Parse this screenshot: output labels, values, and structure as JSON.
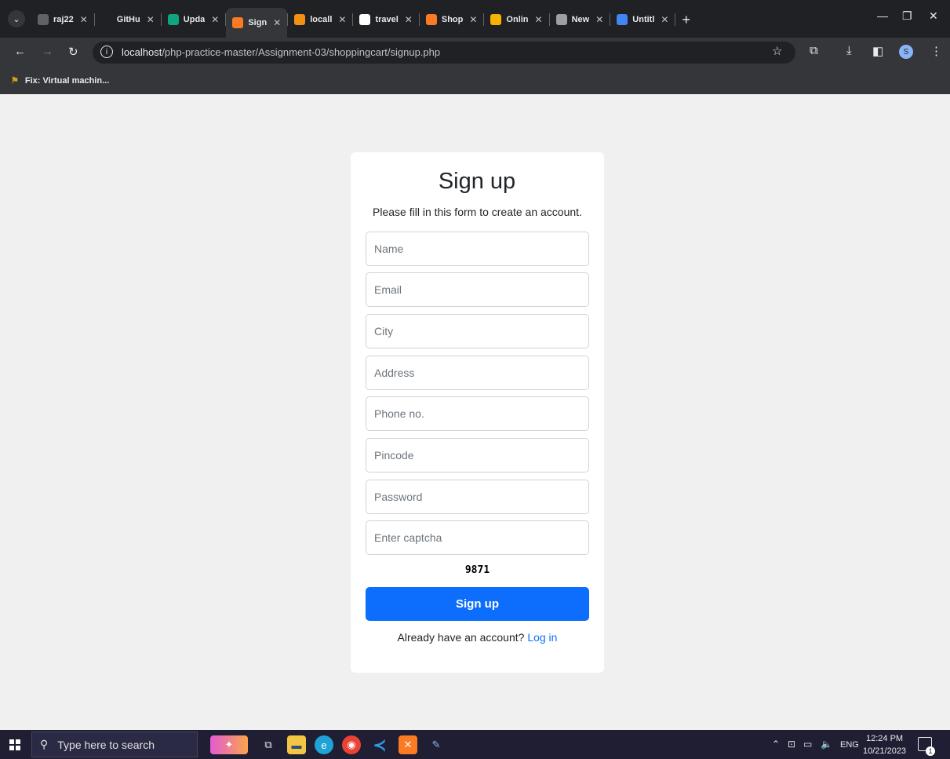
{
  "browser": {
    "tabs": [
      {
        "label": "raj22",
        "icon": "edit-icon",
        "color": "#5f6368",
        "active": false
      },
      {
        "label": "GitHu",
        "icon": "github-icon",
        "color": "#202124",
        "active": false
      },
      {
        "label": "Upda",
        "icon": "chatgpt-icon",
        "color": "#10a37f",
        "active": false
      },
      {
        "label": "Sign",
        "icon": "xampp-icon",
        "color": "#fb7a24",
        "active": true
      },
      {
        "label": "locall",
        "icon": "phpmyadmin-icon",
        "color": "#f29111",
        "active": false
      },
      {
        "label": "travel",
        "icon": "google-icon",
        "color": "#ffffff",
        "active": false
      },
      {
        "label": "Shop",
        "icon": "xampp-icon",
        "color": "#fb7a24",
        "active": false
      },
      {
        "label": "Onlin",
        "icon": "online-icon",
        "color": "#f4b400",
        "active": false
      },
      {
        "label": "New",
        "icon": "chrome-icon",
        "color": "#9aa0a6",
        "active": false
      },
      {
        "label": "Untitl",
        "icon": "docs-icon",
        "color": "#4285f4",
        "active": false
      }
    ],
    "url_host": "localhost",
    "url_path": "/php-practice-master/Assignment-03/shoppingcart/signup.php",
    "bookmark": "Fix: Virtual machin...",
    "profile_initial": "S"
  },
  "form": {
    "title": "Sign up",
    "subtitle": "Please fill in this form to create an account.",
    "placeholders": {
      "name": "Name",
      "email": "Email",
      "city": "City",
      "address": "Address",
      "phone": "Phone no.",
      "pincode": "Pincode",
      "password": "Password",
      "captcha": "Enter captcha"
    },
    "captcha_code": "9871",
    "submit_label": "Sign up",
    "login_prompt": "Already have an account?",
    "login_link": "Log in"
  },
  "taskbar": {
    "search_placeholder": "Type here to search",
    "language": "ENG",
    "time": "12:24 PM",
    "date": "10/21/2023",
    "notification_count": "1"
  },
  "colors": {
    "primary": "#0d6efd",
    "page_bg": "#f0f0f0",
    "chrome_bg": "#202124"
  }
}
